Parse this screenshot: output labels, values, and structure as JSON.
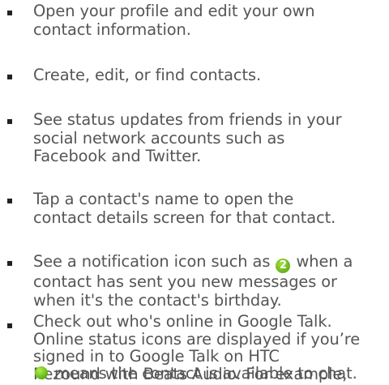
{
  "bullets": [
    {
      "lines": [
        "Open your profile and edit your own",
        "contact information."
      ]
    },
    {
      "lines": [
        "Create, edit, or find contacts."
      ]
    },
    {
      "lines": [
        "See status updates from friends in your",
        "social network accounts such as",
        "Facebook and Twitter."
      ]
    },
    {
      "lines": [
        "Tap a contact's name to open the",
        "contact details screen for that contact."
      ]
    },
    {
      "line1_before": "See a notification icon such as",
      "badge_number": "2",
      "line1_after": "when a",
      "lines_rest": [
        "contact has sent you new messages or",
        "when it's the contact's birthday."
      ]
    },
    {
      "lines": [
        "Check out who's online in Google Talk.",
        "Online status icons are displayed if you’re",
        "signed in to Google Talk on HTC",
        "Rezound with Beats Audio. For example,"
      ],
      "last_line_text": "means the contact is available to chat.",
      "status_icon": "online-status-icon"
    }
  ],
  "colors": {
    "text": "#555555",
    "bullet": "#222222",
    "badge_green": "#6fb820",
    "online_green": "#6cc21e"
  }
}
